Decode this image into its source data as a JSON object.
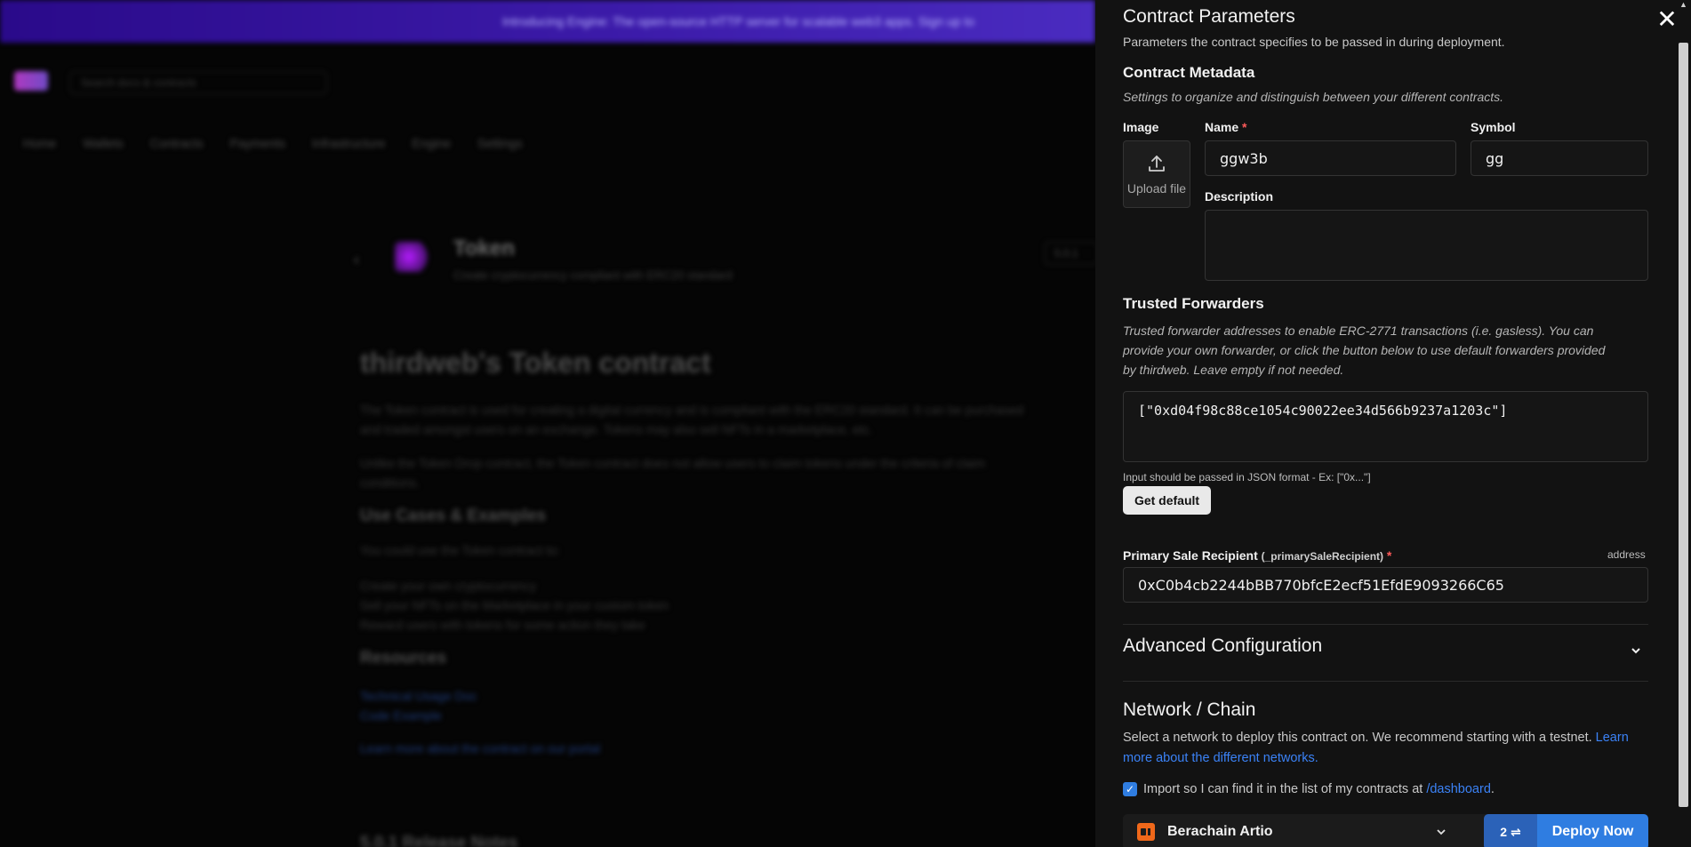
{
  "background": {
    "banner_text": "Introducing Engine: The open-source HTTP server for scalable web3 apps. Sign up to",
    "search_placeholder": "Search docs & contracts",
    "nav": [
      "Home",
      "Wallets",
      "Contracts",
      "Payments",
      "Infrastructure",
      "Engine",
      "Settings"
    ],
    "contract_title": "Token",
    "contract_subtitle": "Create cryptocurrency compliant with ERC20 standard",
    "version_select": "5.0.1",
    "heading": "thirdweb's Token contract",
    "para1": "The Token contract is used for creating a digital currency and is compliant with the ERC20 standard. It can be purchased and traded amongst users on an exchange. Tokens may also sell NFTs in a marketplace, etc.",
    "para2": "Unlike the Token Drop contract, the Token contract does not allow users to claim tokens under the criteria of claim conditions.",
    "use_cases_heading": "Use Cases & Examples",
    "use_cases_intro": "You could use the Token contract to:",
    "use_cases": [
      "Create your own cryptocurrency",
      "Sell your NFTs on the Marketplace in your custom token",
      "Reward users with tokens for some action they take"
    ],
    "resources_heading": "Resources",
    "resources": [
      "Technical Usage Doc",
      "Code Example"
    ],
    "learn_link": "Learn more about the contract on our portal",
    "release_heading": "5.0.1 Release Notes"
  },
  "drawer": {
    "params_title": "Contract Parameters",
    "params_desc": "Parameters the contract specifies to be passed in during deployment.",
    "metadata_title": "Contract Metadata",
    "metadata_desc": "Settings to organize and distinguish between your different contracts.",
    "image_label": "Image",
    "upload_label": "Upload file",
    "name_label": "Name",
    "name_value": "ggw3b",
    "symbol_label": "Symbol",
    "symbol_value": "gg",
    "description_label": "Description",
    "description_value": "",
    "forwarders_title": "Trusted Forwarders",
    "forwarders_desc_1": "Trusted forwarder addresses to enable ERC-2771 transactions (i.e. gasless). You can",
    "forwarders_desc_2": "provide your own forwarder, or click the button below to use default forwarders provided",
    "forwarders_desc_3": "by thirdweb. Leave empty if not needed.",
    "forwarders_value": "[\"0xd04f98c88ce1054c90022ee34d566b9237a1203c\"]",
    "forwarders_hint": "Input should be passed in JSON format - Ex: [\"0x...\"]",
    "get_default": "Get default",
    "recipient_label": "Primary Sale Recipient",
    "recipient_param": "(_primarySaleRecipient)",
    "recipient_type": "address",
    "recipient_value": "0xC0b4cb2244bBB770bfcE2ecf51EfdE9093266C65",
    "advanced_title": "Advanced Configuration",
    "network_title": "Network / Chain",
    "network_desc_1": "Select a network to deploy this contract on. We recommend starting with a testnet.",
    "network_link_1": "Learn",
    "network_link_2": "more about the different networks.",
    "import_text": "Import so I can find it in the list of my contracts at",
    "import_link": "/dashboard",
    "import_period": ".",
    "network_value": "Berachain Artio",
    "deploy_count": "2 ⇌",
    "deploy_label": "Deploy Now"
  },
  "colors": {
    "accent": "#2f7de1",
    "drawer_bg": "#121212",
    "required": "#ff5a5a"
  }
}
